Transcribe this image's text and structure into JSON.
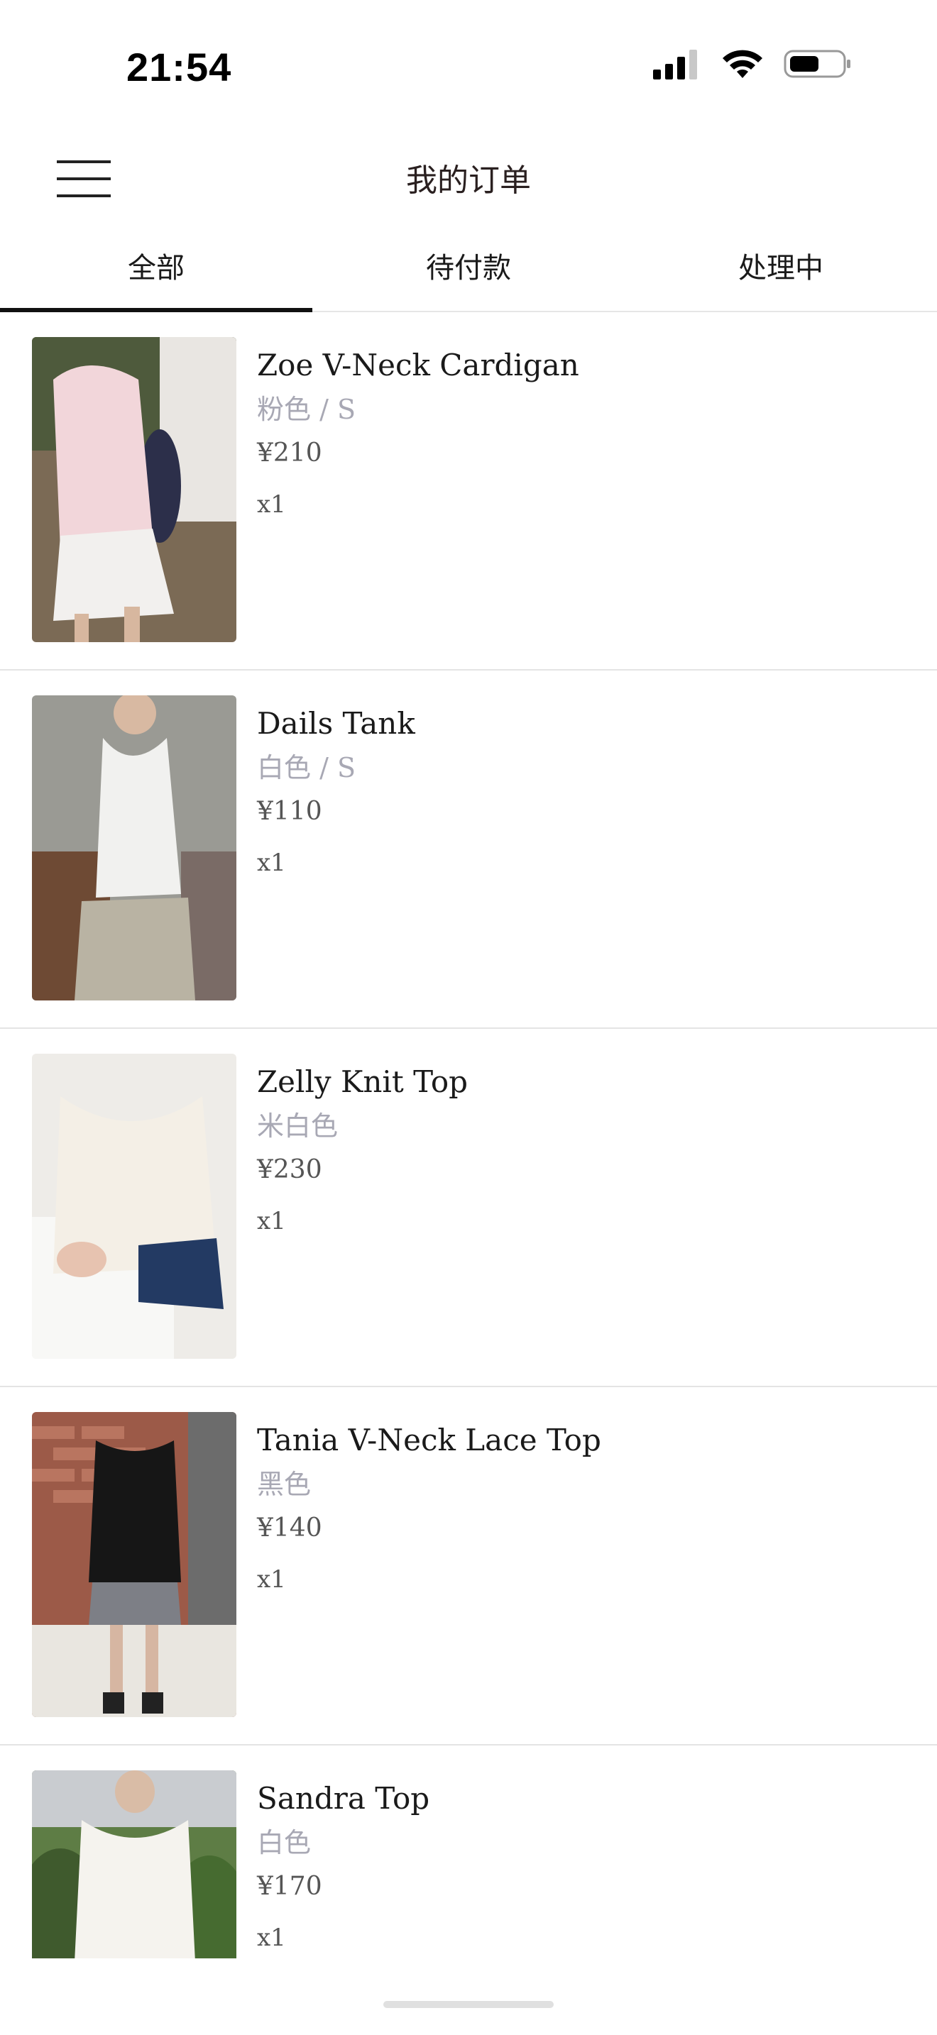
{
  "status_bar": {
    "time": "21:54",
    "icons": [
      "cellular-signal-icon",
      "wifi-icon",
      "battery-icon"
    ]
  },
  "header": {
    "title": "我的订单",
    "menu_icon": "hamburger-menu-icon"
  },
  "tabs": [
    {
      "label": "全部",
      "active": true
    },
    {
      "label": "待付款",
      "active": false
    },
    {
      "label": "处理中",
      "active": false
    }
  ],
  "orders": [
    {
      "name": "Zoe V-Neck Cardigan",
      "variant": "粉色 / S",
      "price": "¥210",
      "qty": "x1"
    },
    {
      "name": "Dails Tank",
      "variant": "白色 / S",
      "price": "¥110",
      "qty": "x1"
    },
    {
      "name": "Zelly Knit Top",
      "variant": "米白色",
      "price": "¥230",
      "qty": "x1"
    },
    {
      "name": "Tania V-Neck Lace Top",
      "variant": "黑色",
      "price": "¥140",
      "qty": "x1"
    },
    {
      "name": "Sandra Top",
      "variant": "白色",
      "price": "¥170",
      "qty": "x1"
    }
  ],
  "colors": {
    "accent": "#111111",
    "variant_text": "#a8a8b4",
    "divider": "#e4e4e4"
  }
}
